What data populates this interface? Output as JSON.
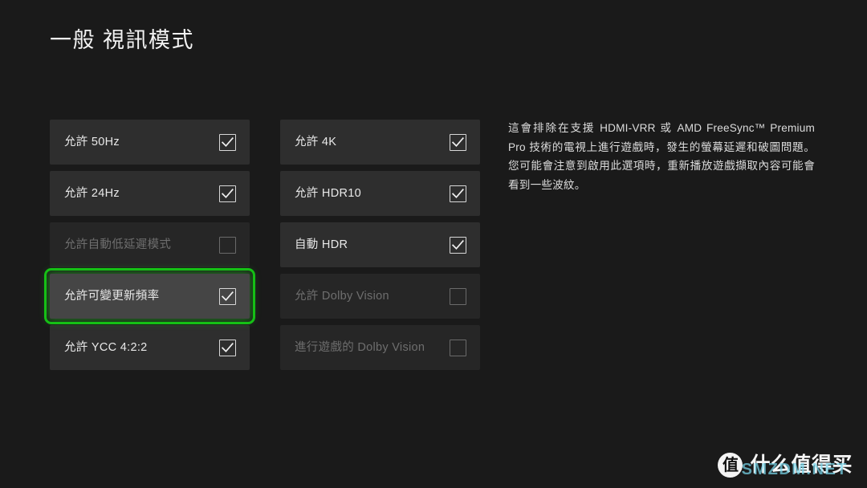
{
  "page": {
    "title": "一般 視訊模式",
    "background_color": "#1a1a1a",
    "focus_color": "#15c015",
    "row_color": "#2e2e2e",
    "row_focused_color": "#454545"
  },
  "columns": {
    "left": {
      "items": [
        {
          "label": "允許 50Hz",
          "checked": true,
          "disabled": false,
          "focused": false
        },
        {
          "label": "允許 24Hz",
          "checked": true,
          "disabled": false,
          "focused": false
        },
        {
          "label": "允許自動低延遲模式",
          "checked": false,
          "disabled": true,
          "focused": false
        },
        {
          "label": "允許可變更新頻率",
          "checked": true,
          "disabled": false,
          "focused": true
        },
        {
          "label": "允許 YCC 4:2:2",
          "checked": true,
          "disabled": false,
          "focused": false
        }
      ]
    },
    "middle": {
      "items": [
        {
          "label": "允許 4K",
          "checked": true,
          "disabled": false,
          "focused": false
        },
        {
          "label": "允許 HDR10",
          "checked": true,
          "disabled": false,
          "focused": false
        },
        {
          "label": "自動 HDR",
          "checked": true,
          "disabled": false,
          "focused": false
        },
        {
          "label": "允許 Dolby Vision",
          "checked": false,
          "disabled": true,
          "focused": false
        },
        {
          "label": "進行遊戲的 Dolby Vision",
          "checked": false,
          "disabled": true,
          "focused": false
        }
      ]
    }
  },
  "description": {
    "text": "這會排除在支援 HDMI-VRR 或 AMD FreeSync™ Premium Pro 技術的電視上進行遊戲時，發生的螢幕延遲和破圖問題。您可能會注意到啟用此選項時，重新播放遊戲擷取內容可能會看到一些波紋。"
  },
  "watermark": {
    "logo_char": "值",
    "text": "什么值得买",
    "overlay": "SMZDM.NET"
  }
}
